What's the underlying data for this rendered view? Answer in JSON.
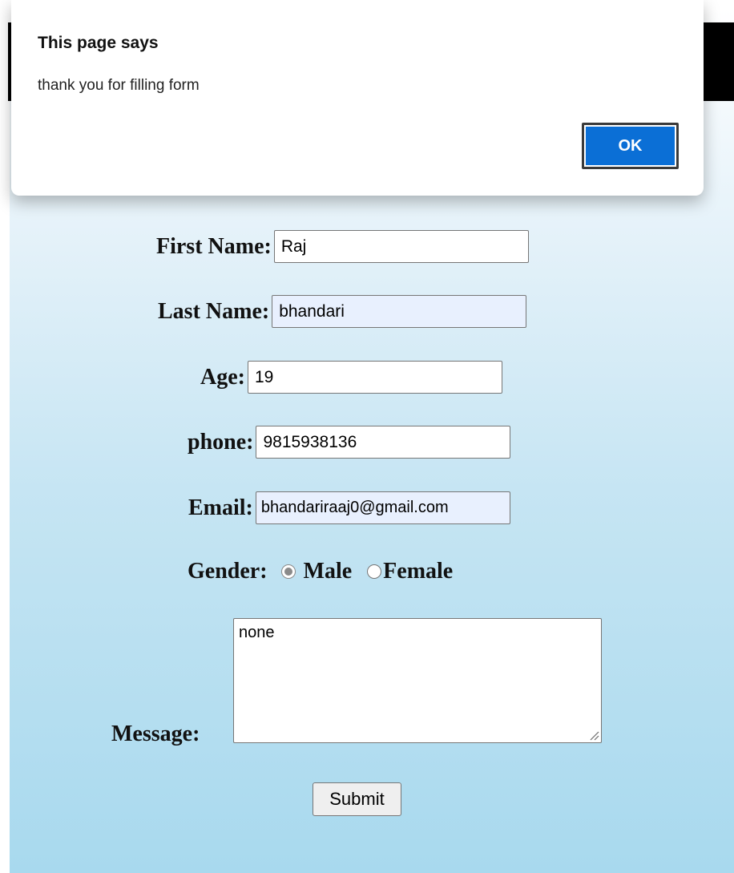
{
  "dialog": {
    "title": "This page says",
    "message": "thank you for filling form",
    "ok_label": "OK"
  },
  "form": {
    "first_name": {
      "label": "First Name:",
      "value": "Raj"
    },
    "last_name": {
      "label": "Last Name:",
      "value": "bhandari"
    },
    "age": {
      "label": "Age:",
      "value": "19"
    },
    "phone": {
      "label": "phone:",
      "value": "9815938136"
    },
    "email": {
      "label": "Email:",
      "value": "bhandariraaj0@gmail.com"
    },
    "gender": {
      "label": "Gender:",
      "options": [
        {
          "label": "Male",
          "checked": true
        },
        {
          "label": "Female",
          "checked": false
        }
      ]
    },
    "message": {
      "label": "Message:",
      "value": "none"
    },
    "submit_label": "Submit"
  },
  "colors": {
    "ok_button": "#0b6fd6",
    "autofill_bg": "#e8f0fe",
    "page_gradient_bottom": "#a8d9ee",
    "header_bar": "#000000"
  }
}
